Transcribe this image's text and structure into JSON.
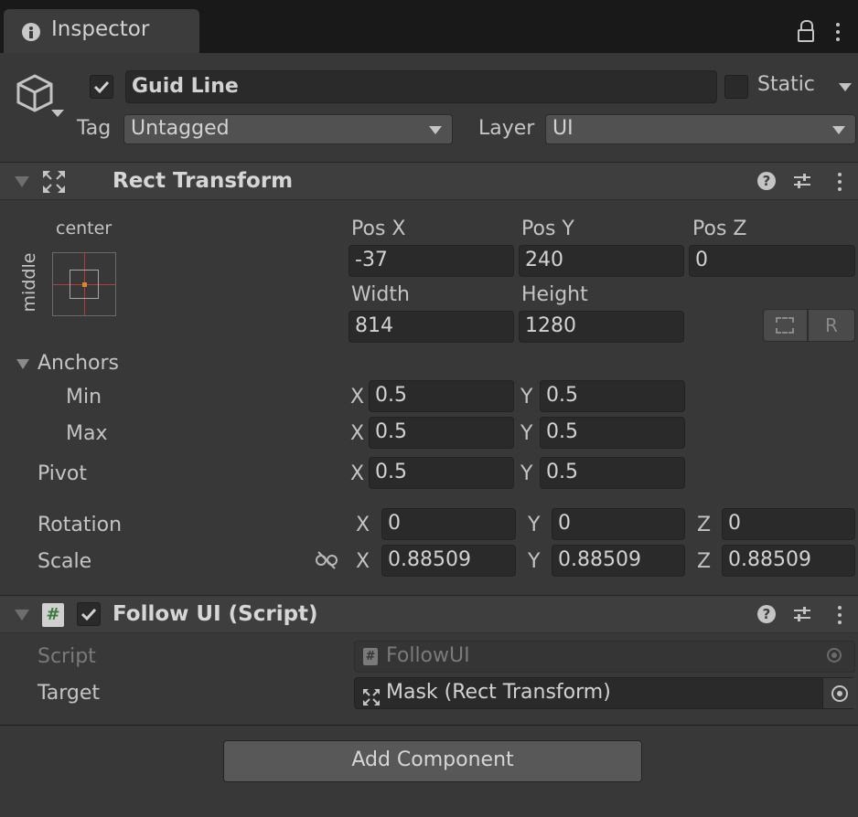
{
  "tab": {
    "title": "Inspector",
    "info_icon": "info-icon",
    "lock_icon": "lock-icon"
  },
  "gameobject": {
    "name": "Guid Line",
    "static_label": "Static",
    "tag_label": "Tag",
    "tag_value": "Untagged",
    "layer_label": "Layer",
    "layer_value": "UI"
  },
  "rect_transform": {
    "title": "Rect Transform",
    "anchor_h": "center",
    "anchor_v": "middle",
    "pos_x_label": "Pos X",
    "pos_x": "-37",
    "pos_y_label": "Pos Y",
    "pos_y": "240",
    "pos_z_label": "Pos Z",
    "pos_z": "0",
    "width_label": "Width",
    "width": "814",
    "height_label": "Height",
    "height": "1280",
    "r_button": "R",
    "anchors_label": "Anchors",
    "min_label": "Min",
    "min_x": "0.5",
    "min_y": "0.5",
    "max_label": "Max",
    "max_x": "0.5",
    "max_y": "0.5",
    "pivot_label": "Pivot",
    "pivot_x": "0.5",
    "pivot_y": "0.5",
    "rotation_label": "Rotation",
    "rot_x": "0",
    "rot_y": "0",
    "rot_z": "0",
    "scale_label": "Scale",
    "scale_x": "0.88509",
    "scale_y": "0.88509",
    "scale_z": "0.88509",
    "axis_x": "X",
    "axis_y": "Y",
    "axis_z": "Z"
  },
  "follow_ui": {
    "title": "Follow UI (Script)",
    "script_label": "Script",
    "script_value": "FollowUI",
    "target_label": "Target",
    "target_value": "Mask (Rect Transform)",
    "hash_glyph": "#"
  },
  "add_component": "Add Component",
  "colors": {
    "background": "#383838",
    "tabbar": "#191919",
    "field": "#2a2a2a",
    "accent_red": "#b83a3a",
    "anchor_orange": "#d68a2a"
  }
}
